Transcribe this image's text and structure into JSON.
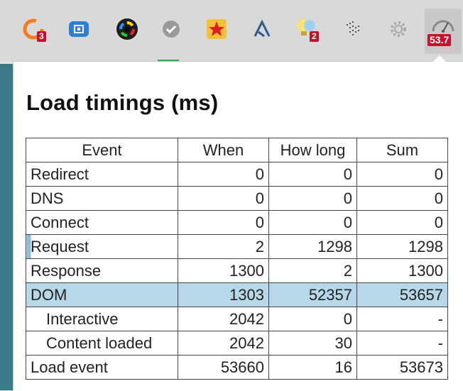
{
  "toolbar": {
    "icons": [
      {
        "name": "sync-icon",
        "badge": "3"
      },
      {
        "name": "screen-share-icon"
      },
      {
        "name": "color-wheel-icon"
      },
      {
        "name": "checkmark-icon"
      },
      {
        "name": "star-icon"
      },
      {
        "name": "path-icon"
      },
      {
        "name": "lightbulb-icon",
        "badge": "2"
      },
      {
        "name": "dots-grid-icon"
      },
      {
        "name": "gear-icon"
      },
      {
        "name": "speedometer-icon",
        "badge": "53.7"
      }
    ],
    "colors": {
      "badge": "#c8102e",
      "accent_orange": "#f47b20",
      "accent_blue": "#2b7fd4"
    }
  },
  "popup": {
    "title": "Load timings (ms)",
    "table": {
      "headers": [
        "Event",
        "When",
        "How long",
        "Sum"
      ],
      "rows": [
        {
          "event": "Redirect",
          "when": "0",
          "how_long": "0",
          "sum": "0"
        },
        {
          "event": "DNS",
          "when": "0",
          "how_long": "0",
          "sum": "0"
        },
        {
          "event": "Connect",
          "when": "0",
          "how_long": "0",
          "sum": "0"
        },
        {
          "event": "Request",
          "when": "2",
          "how_long": "1298",
          "sum": "1298"
        },
        {
          "event": "Response",
          "when": "1300",
          "how_long": "2",
          "sum": "1300"
        },
        {
          "event": "DOM",
          "when": "1303",
          "how_long": "52357",
          "sum": "53657"
        },
        {
          "event": "Interactive",
          "when": "2042",
          "how_long": "0",
          "sum": "-"
        },
        {
          "event": "Content loaded",
          "when": "2042",
          "how_long": "30",
          "sum": "-"
        },
        {
          "event": "Load event",
          "when": "53660",
          "how_long": "16",
          "sum": "53673"
        }
      ]
    },
    "highlight_color": "#b7d8e8"
  }
}
